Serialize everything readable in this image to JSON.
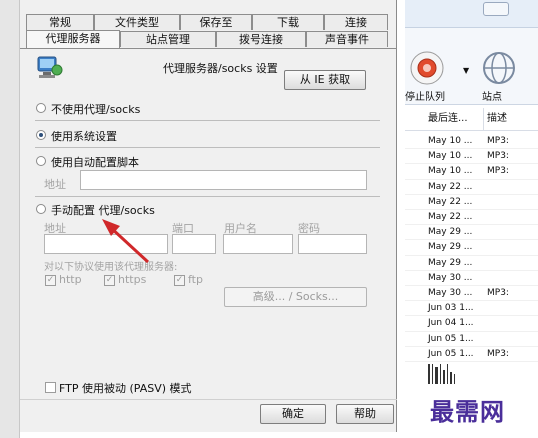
{
  "dialog": {
    "tabs_row1": [
      "常规",
      "文件类型",
      "保存至",
      "下载",
      "连接"
    ],
    "tabs_row2": [
      "代理服务器",
      "站点管理",
      "拨号连接",
      "声音事件"
    ],
    "proxy_socks_settings_label": "代理服务器/socks 设置",
    "from_ie_button": "从 IE 获取",
    "options": {
      "no_proxy": "不使用代理/socks",
      "use_system": "使用系统设置",
      "use_auto_script": "使用自动配置脚本",
      "manual": "手动配置 代理/socks"
    },
    "selected_option": "use_system",
    "auto_address_label": "地址",
    "manual_fields": {
      "address_label": "地址",
      "port_label": "端口",
      "username_label": "用户名",
      "password_label": "密码"
    },
    "protocols_label": "对以下协议使用该代理服务器:",
    "protocols": [
      {
        "name": "http",
        "checked": true
      },
      {
        "name": "https",
        "checked": true
      },
      {
        "name": "ftp",
        "checked": true
      }
    ],
    "advanced_button": "高级... / Socks...",
    "ftp_passive_label": "FTP 使用被动 (PASV) 模式",
    "ok_button": "确定",
    "help_button": "帮助"
  },
  "app": {
    "toolbar": {
      "stop_queue_label": "停止队列",
      "site_label": "站点"
    },
    "columns": [
      "最后连...",
      "描述"
    ],
    "rows": [
      {
        "last": "May 10 ...",
        "desc": "MP3:"
      },
      {
        "last": "May 10 ...",
        "desc": "MP3:"
      },
      {
        "last": "May 10 ...",
        "desc": "MP3:"
      },
      {
        "last": "May 22 ...",
        "desc": ""
      },
      {
        "last": "May 22 ...",
        "desc": ""
      },
      {
        "last": "May 22 ...",
        "desc": ""
      },
      {
        "last": "May 29 ...",
        "desc": ""
      },
      {
        "last": "May 29 ...",
        "desc": ""
      },
      {
        "last": "May 29 ...",
        "desc": ""
      },
      {
        "last": "May 30 ...",
        "desc": ""
      },
      {
        "last": "May 30 ...",
        "desc": "MP3:"
      },
      {
        "last": "Jun 03 1...",
        "desc": ""
      },
      {
        "last": "Jun 04 1...",
        "desc": ""
      },
      {
        "last": "Jun 05 1...",
        "desc": ""
      },
      {
        "last": "Jun 05 1...",
        "desc": "MP3:"
      }
    ]
  },
  "watermark": "最需网",
  "colors": {
    "dialog_bg": "#f0f0f0",
    "arrow": "#d0282a",
    "watermark": "#4a2e9a",
    "radio_checked": "#2d4f7a"
  }
}
